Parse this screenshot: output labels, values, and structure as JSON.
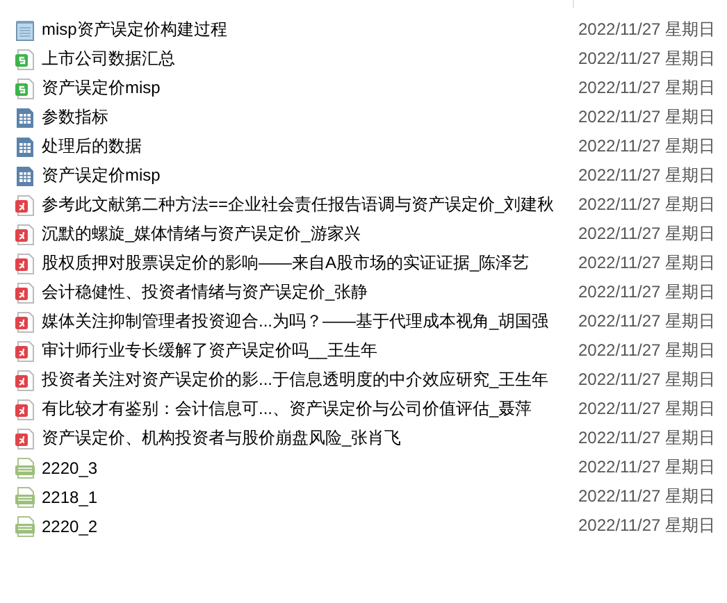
{
  "files": [
    {
      "kind": "text",
      "name": "misp资产误定价构建过程",
      "date": "2022/11/27 星期日"
    },
    {
      "kind": "sheet",
      "name": "上市公司数据汇总",
      "date": "2022/11/27 星期日"
    },
    {
      "kind": "sheet",
      "name": "资产误定价misp",
      "date": "2022/11/27 星期日"
    },
    {
      "kind": "table",
      "name": "参数指标",
      "date": "2022/11/27 星期日"
    },
    {
      "kind": "table",
      "name": "处理后的数据",
      "date": "2022/11/27 星期日"
    },
    {
      "kind": "table",
      "name": "资产误定价misp",
      "date": "2022/11/27 星期日"
    },
    {
      "kind": "pdf",
      "name": "参考此文献第二种方法==企业社会责任报告语调与资产误定价_刘建秋",
      "date": "2022/11/27 星期日"
    },
    {
      "kind": "pdf",
      "name": "沉默的螺旋_媒体情绪与资产误定价_游家兴",
      "date": "2022/11/27 星期日"
    },
    {
      "kind": "pdf",
      "name": "股权质押对股票误定价的影响——来自A股市场的实证证据_陈泽艺",
      "date": "2022/11/27 星期日"
    },
    {
      "kind": "pdf",
      "name": "会计稳健性、投资者情绪与资产误定价_张静",
      "date": "2022/11/27 星期日"
    },
    {
      "kind": "pdf",
      "name": "媒体关注抑制管理者投资迎合...为吗？——基于代理成本视角_胡国强",
      "date": "2022/11/27 星期日"
    },
    {
      "kind": "pdf",
      "name": "审计师行业专长缓解了资产误定价吗__王生年",
      "date": "2022/11/27 星期日"
    },
    {
      "kind": "pdf",
      "name": "投资者关注对资产误定价的影...于信息透明度的中介效应研究_王生年",
      "date": "2022/11/27 星期日"
    },
    {
      "kind": "pdf",
      "name": "有比较才有鉴别：会计信息可...、资产误定价与公司价值评估_聂萍",
      "date": "2022/11/27 星期日"
    },
    {
      "kind": "pdf",
      "name": "资产误定价、机构投资者与股价崩盘风险_张肖飞",
      "date": "2022/11/27 星期日"
    },
    {
      "kind": "image",
      "name": "2220_3",
      "date": "2022/11/27 星期日"
    },
    {
      "kind": "image",
      "name": "2218_1",
      "date": "2022/11/27 星期日"
    },
    {
      "kind": "image",
      "name": "2220_2",
      "date": "2022/11/27 星期日"
    }
  ]
}
